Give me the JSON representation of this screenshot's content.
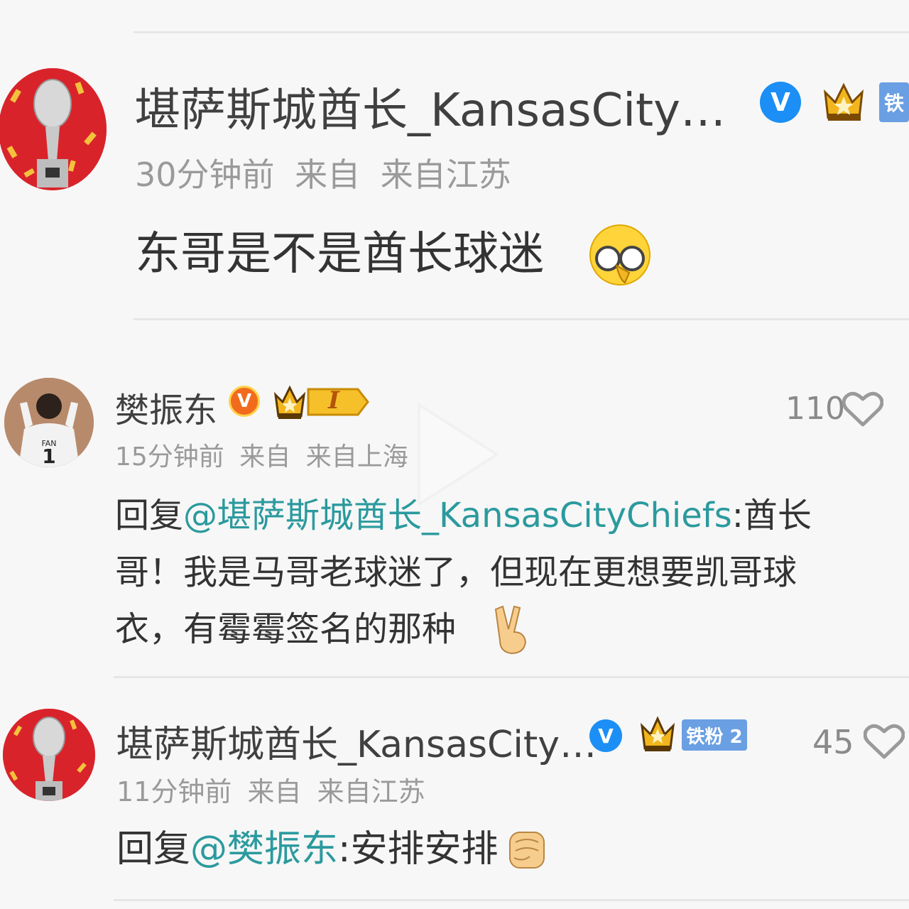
{
  "colors": {
    "mention": "#2b9a9e",
    "verified_blue": "#1b8ff5",
    "verified_orange": "#f26b1d",
    "fan_tag": "#6a9fe3",
    "avatar_red": "#d9232b"
  },
  "comments": [
    {
      "username": "堪萨斯城酋长_KansasCity…",
      "time": "30分钟前",
      "from_label": "来自",
      "location": "来自江苏",
      "text": "东哥是不是酋长球迷",
      "fan_tag": "铁",
      "verified_icon": "verified-blue-icon",
      "emoji_icon": "glasses-face-emoji-icon"
    },
    {
      "username": "樊振东",
      "time": "15分钟前",
      "from_label": "来自",
      "location": "来自上海",
      "reply_prefix": "回复",
      "mention": "@堪萨斯城酋长_KansasCityChiefs",
      "text_line1": ":酋长",
      "text_line2": "哥！我是马哥老球迷了，但现在更想要凯哥球",
      "text_line3": "衣，有霉霉签名的那种",
      "badge_level": "I",
      "likes": "110",
      "verified_icon": "verified-orange-icon",
      "emoji_icon": "victory-hand-emoji-icon",
      "avatar_jersey_number": "1",
      "avatar_jersey_name": "FAN"
    },
    {
      "username": "堪萨斯城酋长_KansasCity…",
      "time": "11分钟前",
      "from_label": "来自",
      "location": "来自江苏",
      "reply_prefix": "回复",
      "mention": "@樊振东",
      "text": ":安排安排",
      "fan_tag": "铁粉 2",
      "likes": "45",
      "verified_icon": "verified-blue-icon",
      "emoji_icon": "fist-emoji-icon"
    }
  ]
}
